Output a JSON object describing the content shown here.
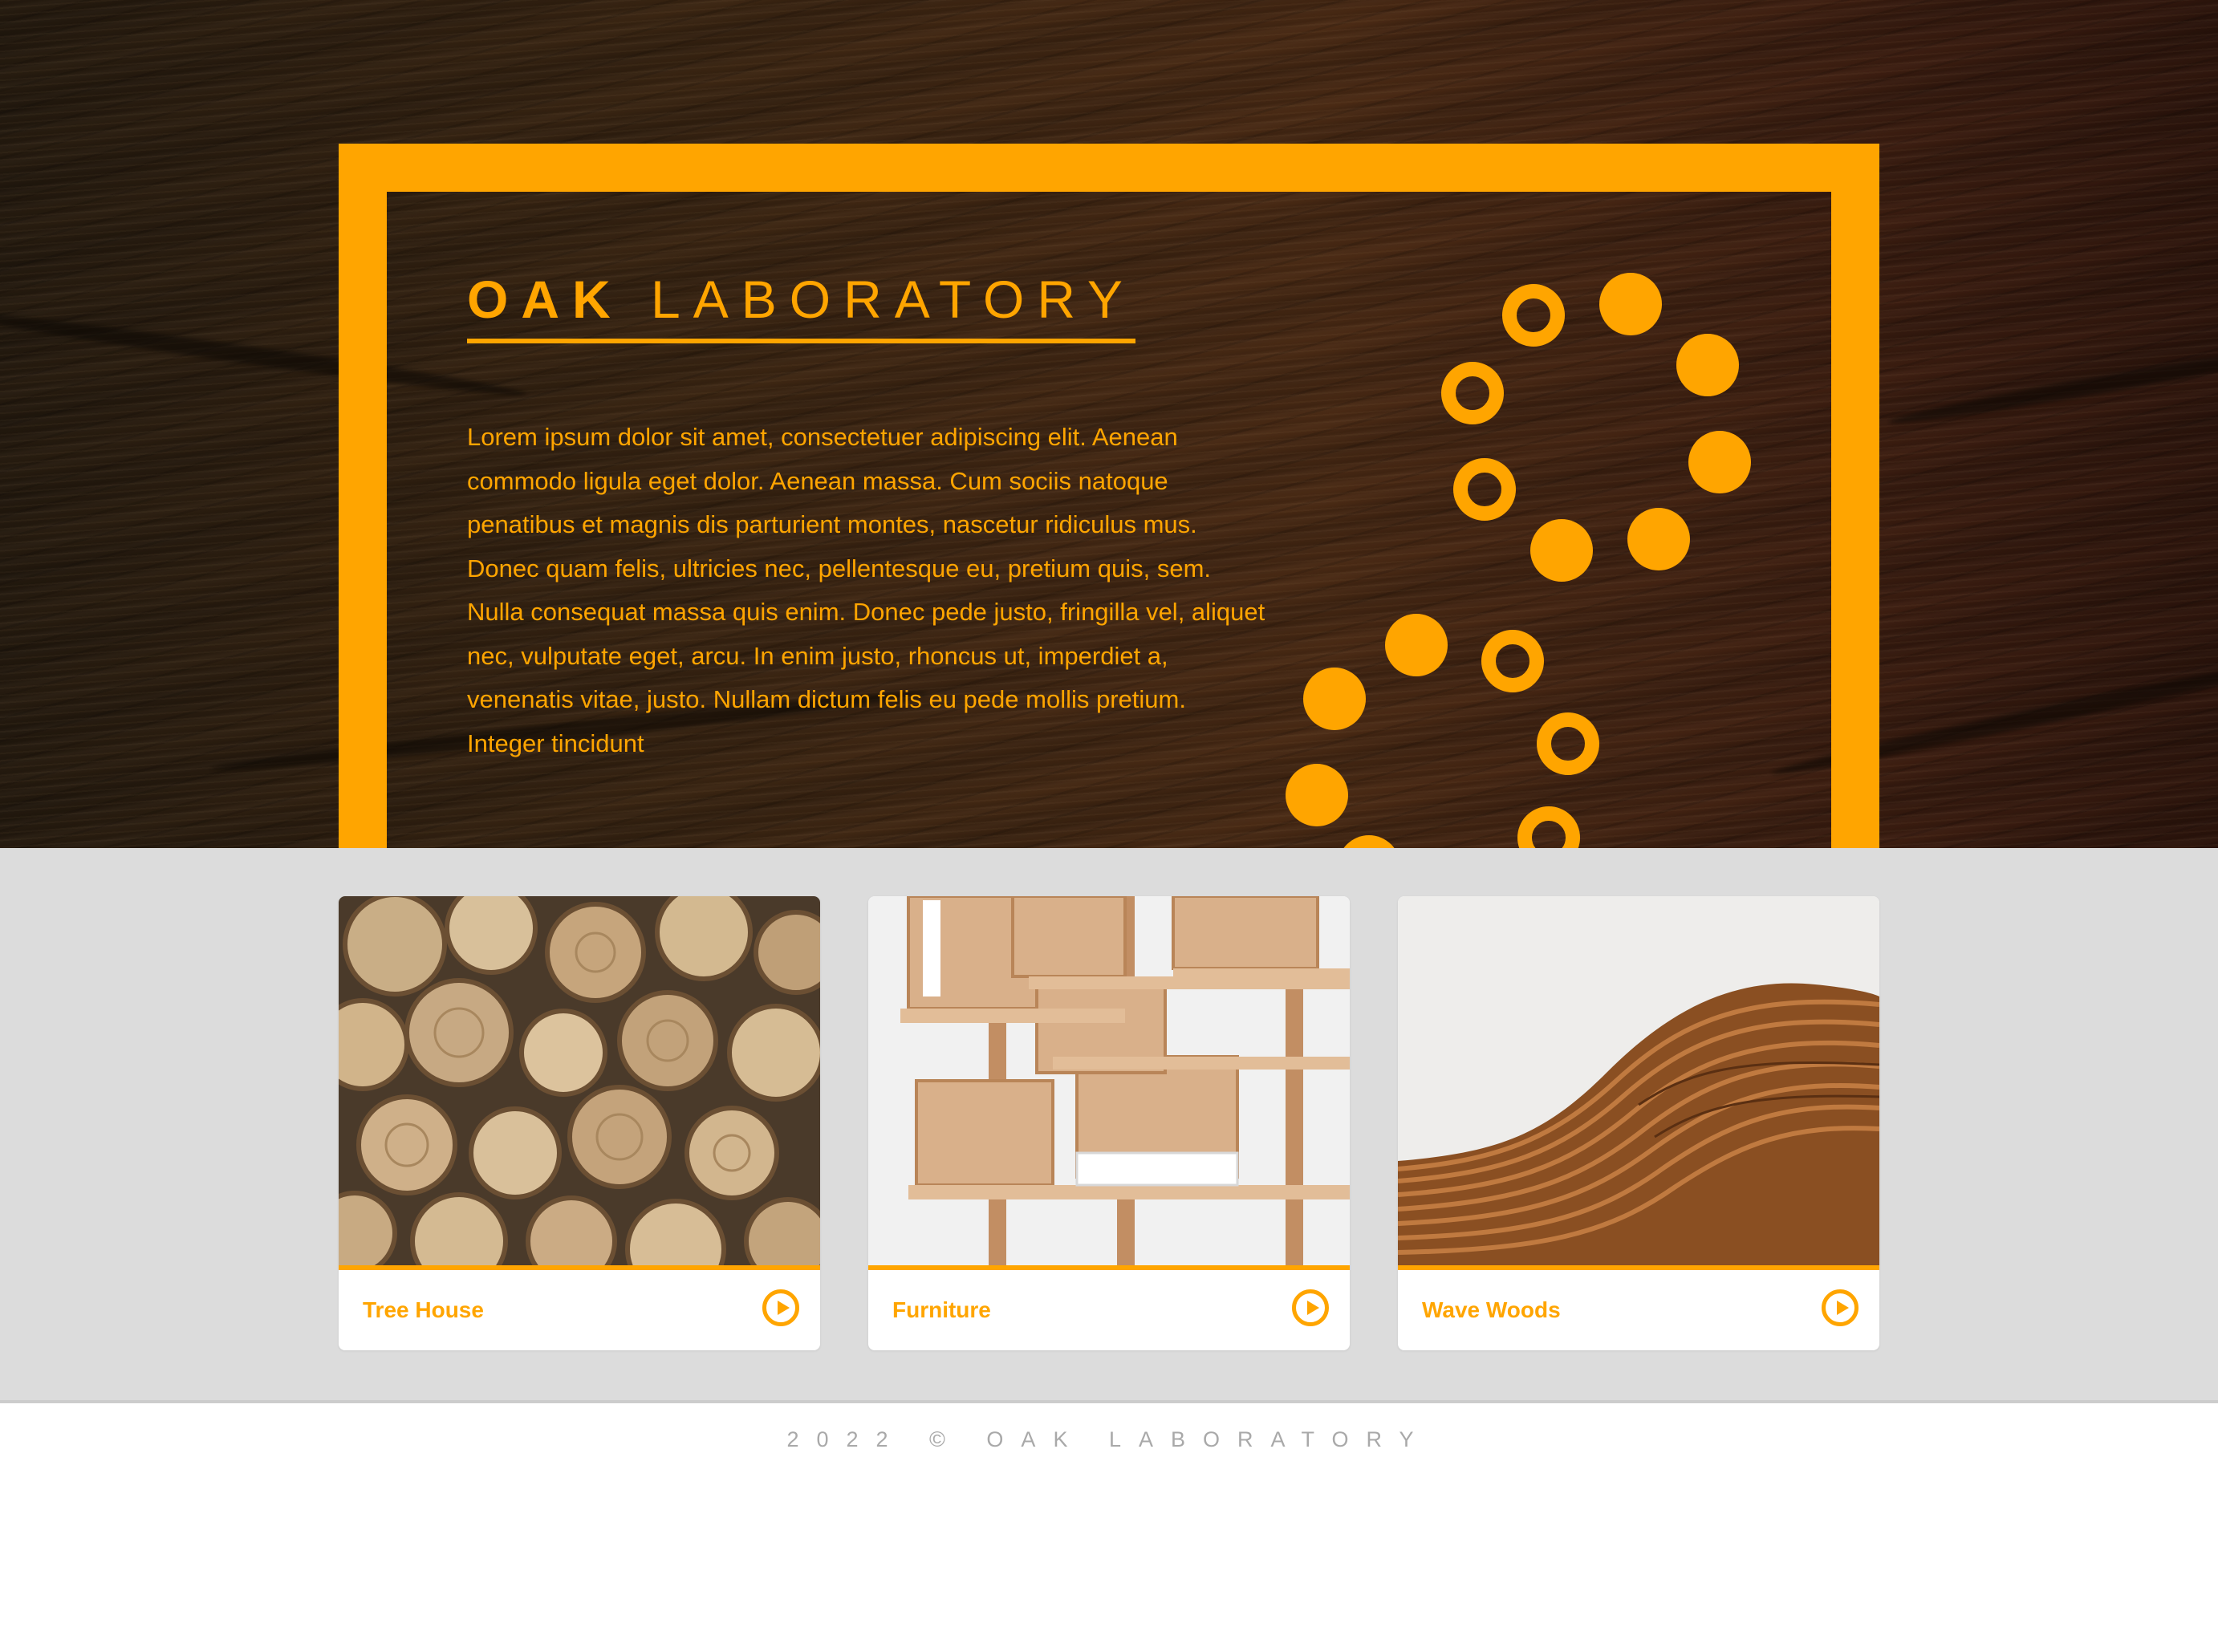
{
  "brand": {
    "name_bold": "OAK",
    "name_light": "LABORATORY",
    "accent": "#ffa500"
  },
  "hero": {
    "body": "Lorem ipsum dolor sit amet, consectetuer adipiscing elit. Aenean commodo ligula eget dolor. Aenean massa. Cum sociis natoque penatibus et magnis dis parturient montes, nascetur ridiculus mus. Donec quam felis, ultricies nec, pellentesque eu, pretium quis, sem. Nulla consequat massa quis enim. Donec pede justo, fringilla vel, aliquet nec, vulputate eget, arcu. In enim justo, rhoncus ut, imperdiet a, venenatis vitae, justo. Nullam dictum felis eu pede mollis pretium. Integer tincidunt",
    "background": "dark wood texture",
    "decoration": "spiral of orange dots and rings"
  },
  "cards": [
    {
      "title": "Tree House",
      "image": "stacked cut logs",
      "action_icon": "play-circle-icon"
    },
    {
      "title": "Furniture",
      "image": "wooden shelving unit",
      "action_icon": "play-circle-icon"
    },
    {
      "title": "Wave Woods",
      "image": "curved wooden slat sculpture",
      "action_icon": "play-circle-icon"
    }
  ],
  "footer": {
    "text": "2022 © OAK LABORATORY"
  }
}
